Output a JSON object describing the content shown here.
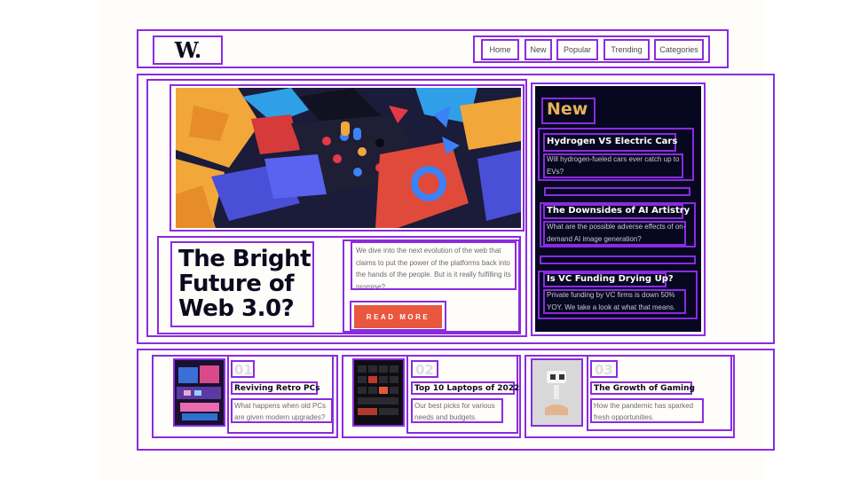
{
  "header": {
    "logo": "W.",
    "nav": [
      "Home",
      "New",
      "Popular",
      "Trending",
      "Categories"
    ]
  },
  "hero": {
    "headline": "The Bright Future of Web 3.0?",
    "description": "We dive into the next evolution of the web that claims to put the power of the platforms back into the hands of the people. But is it really fulfilling its promise?",
    "button": "READ MORE"
  },
  "sidebar": {
    "title": "New",
    "items": [
      {
        "title": "Hydrogen VS Electric Cars",
        "desc": "Will hydrogen-fueled cars ever catch up to EVs?"
      },
      {
        "title": "The Downsides of AI Artistry",
        "desc": "What are the possible adverse effects of on-demand AI image generation?"
      },
      {
        "title": "Is VC Funding Drying Up?",
        "desc": "Private funding by VC firms is down 50% YOY. We take a look at what that means."
      }
    ]
  },
  "cards": [
    {
      "num": "01",
      "title": "Reviving Retro PCs",
      "desc": "What happens when old PCs are given modern upgrades?"
    },
    {
      "num": "02",
      "title": "Top 10 Laptops of 2022",
      "desc": "Our best picks for various needs and budgets."
    },
    {
      "num": "03",
      "title": "The Growth of Gaming",
      "desc": "How the pandemic has sparked fresh opportunities."
    }
  ],
  "colors": {
    "accent": "#e9573f",
    "gold": "#e6b357",
    "dark": "#070720",
    "annotation": "#8a2be2"
  }
}
